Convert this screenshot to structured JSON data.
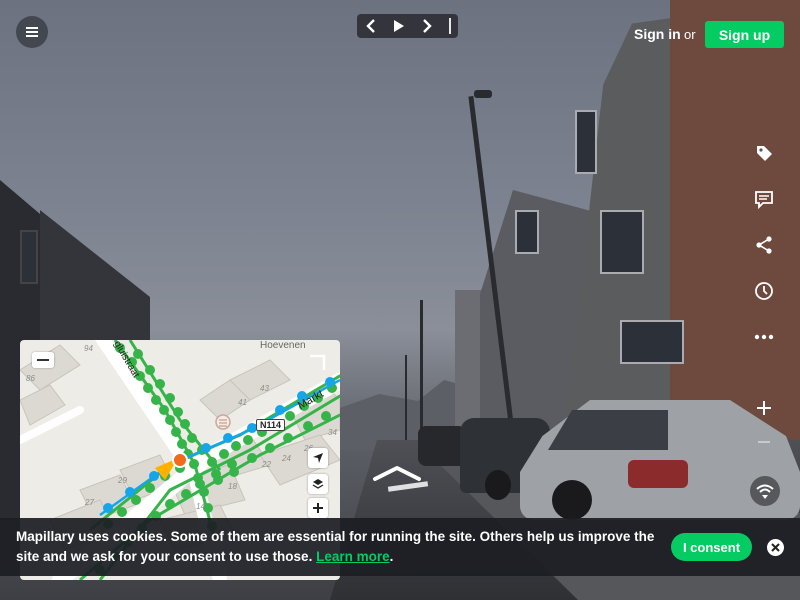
{
  "top": {
    "menu_icon": "hamburger-icon",
    "sequence_controls": [
      "chevron-left-icon",
      "play-icon",
      "chevron-right-icon",
      "pipe-separator"
    ],
    "signin_label": "Sign in",
    "or_label": "or",
    "signup_label": "Sign up"
  },
  "right_rail": {
    "icons": [
      "tag-icon",
      "comment-icon",
      "share-icon",
      "clock-icon",
      "more-icon",
      "zoom-in-icon",
      "zoom-out-icon",
      "wifi-icon"
    ]
  },
  "minimap": {
    "place_label": "Hoevenen",
    "road_shield": "N114",
    "street_markt": "Markt",
    "street_top": "gluistraat",
    "house_numbers": [
      "94",
      "86",
      "43",
      "41",
      "29",
      "27",
      "22",
      "24",
      "18",
      "14",
      "26",
      "34"
    ],
    "controls": [
      "locate-icon",
      "layers-icon",
      "zoom-in-icon"
    ]
  },
  "cookie_banner": {
    "text": "Mapillary uses cookies. Some of them are essential for running the site. Others help us improve the site and we ask for your consent to use those.",
    "link_label": "Learn more",
    "period": ".",
    "consent_label": "I consent",
    "close_icon": "close-icon"
  },
  "colors": {
    "accent_green": "#05cb63",
    "sequence_green": "#35b449",
    "sequence_blue": "#16a5e8",
    "current_position": "#f26b1d",
    "camera_cone": "#ffb000"
  }
}
